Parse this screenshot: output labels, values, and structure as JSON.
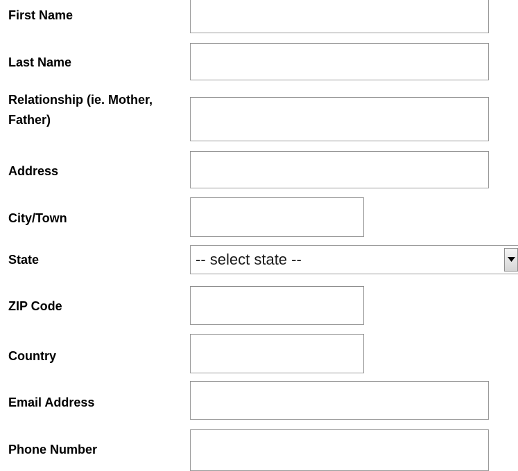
{
  "form": {
    "fields": {
      "first_name": {
        "label": "First Name",
        "value": ""
      },
      "last_name": {
        "label": "Last Name",
        "value": ""
      },
      "relationship": {
        "label": "Relationship (ie. Mother, Father)",
        "value": ""
      },
      "address": {
        "label": "Address",
        "value": ""
      },
      "city": {
        "label": "City/Town",
        "value": ""
      },
      "state": {
        "label": "State",
        "selected": "-- select state --"
      },
      "zip": {
        "label": "ZIP Code",
        "value": ""
      },
      "country": {
        "label": "Country",
        "value": ""
      },
      "email": {
        "label": "Email Address",
        "value": ""
      },
      "phone": {
        "label": "Phone Number",
        "value": ""
      }
    }
  },
  "icons": {
    "state_dropdown": "chevron-down-icon"
  }
}
